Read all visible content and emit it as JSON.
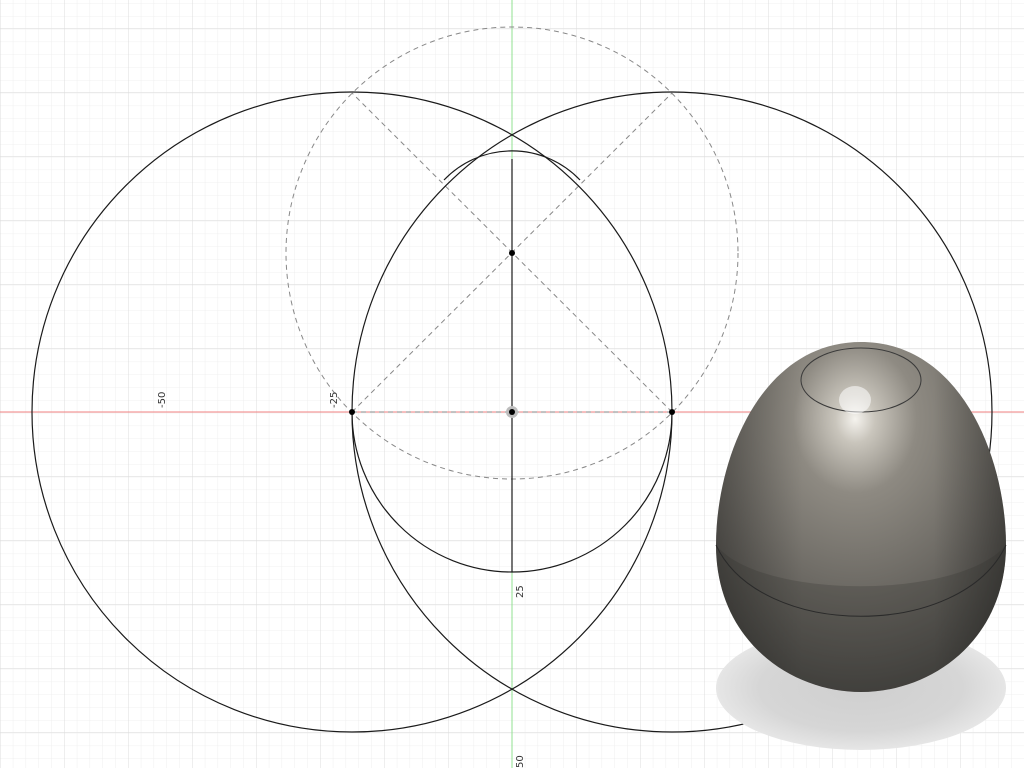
{
  "canvas": {
    "background": "#ffffff",
    "grid_minor_color": "#ececec",
    "grid_major_color": "#dcdcdc",
    "x_axis_color": "#f08080",
    "y_axis_color": "#90e090"
  },
  "dimension_labels": {
    "neg50": "-50",
    "neg25": "-25",
    "pos25": "25",
    "pos50": "50"
  },
  "sketch": {
    "line_color": "#1a1a1a",
    "construction_color": "#888888",
    "point_color": "#000000"
  },
  "body": {
    "name": "egg",
    "material_color": "#7d7a73",
    "shadow_color": "#d3d3d3"
  }
}
